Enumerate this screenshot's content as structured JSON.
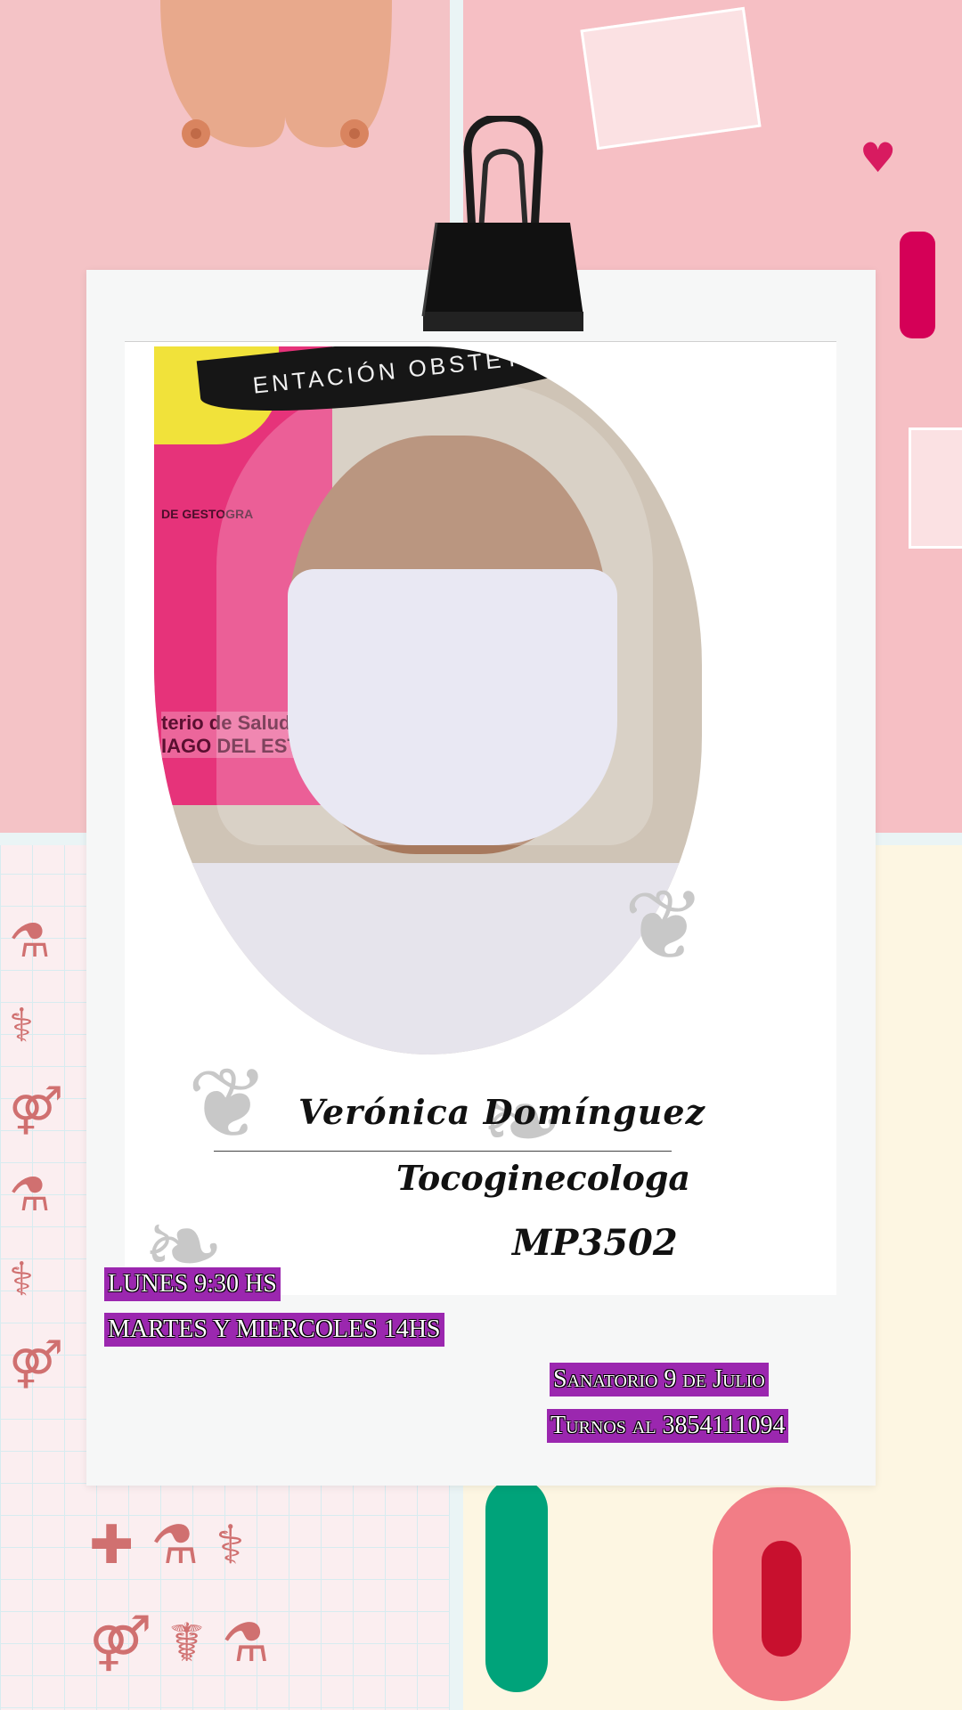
{
  "profile": {
    "name": "Verónica Domínguez",
    "specialty": "Tocoginecologa",
    "license": "MP3502"
  },
  "schedule": {
    "line1": "LUNES 9:30 HS",
    "line2": "MARTES Y MIERCOLES  14HS"
  },
  "location": {
    "place": "Sanatorio 9 de Julio",
    "appointments": "Turnos al 3854111094"
  },
  "photo": {
    "band_text": "ENTACIÓN OBSTETRIC",
    "poster_text_1": "DE GESTOGRA",
    "poster_text_2": "terio de Salud\nIAGO DEL ESTERO"
  },
  "colors": {
    "highlight": "#9b27af",
    "card": "#f6f7f7",
    "background_pink": "#f4c3c6",
    "background_cream": "#fdf6e2"
  },
  "icons": [
    "binder-clip-icon",
    "heart-icon",
    "breast-icon",
    "medical-icons-pattern",
    "vulva-illustration-icon"
  ]
}
